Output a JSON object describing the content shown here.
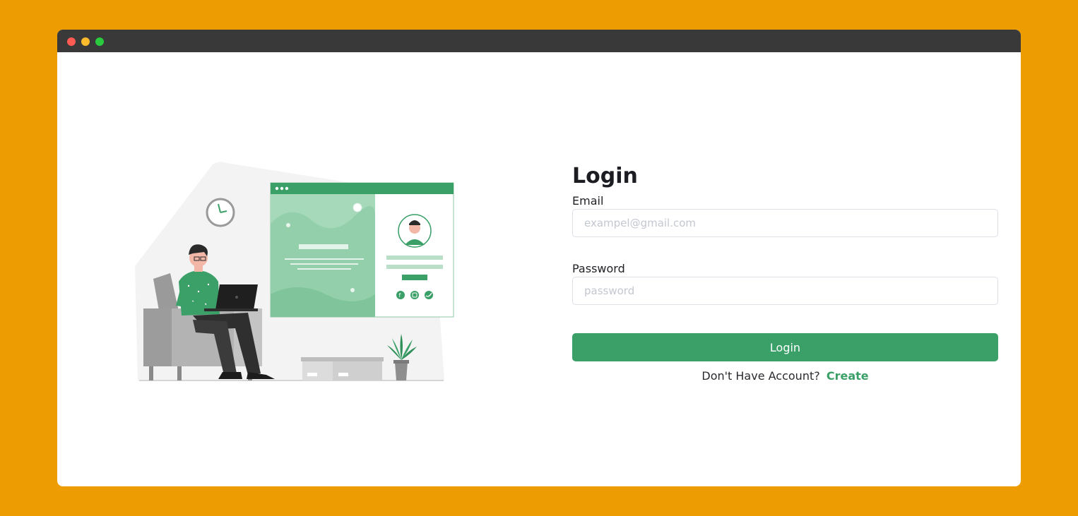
{
  "colors": {
    "page_background": "#ED9D02",
    "accent": "#3AA068",
    "titlebar": "#393939"
  },
  "window_controls": [
    "close",
    "minimize",
    "maximize"
  ],
  "login": {
    "title": "Login",
    "email_label": "Email",
    "email_placeholder": "exampel@gmail.com",
    "email_value": "",
    "password_label": "Password",
    "password_placeholder": "password",
    "password_value": "",
    "submit_label": "Login",
    "signup_prompt": "Don't Have Account?",
    "signup_link": "Create"
  },
  "illustration": {
    "subject": "person with laptop on armchair next to profile web page",
    "icons": [
      "clock-icon",
      "facebook-icon",
      "instagram-icon",
      "twitter-icon",
      "plant-icon",
      "armchair-icon"
    ]
  }
}
